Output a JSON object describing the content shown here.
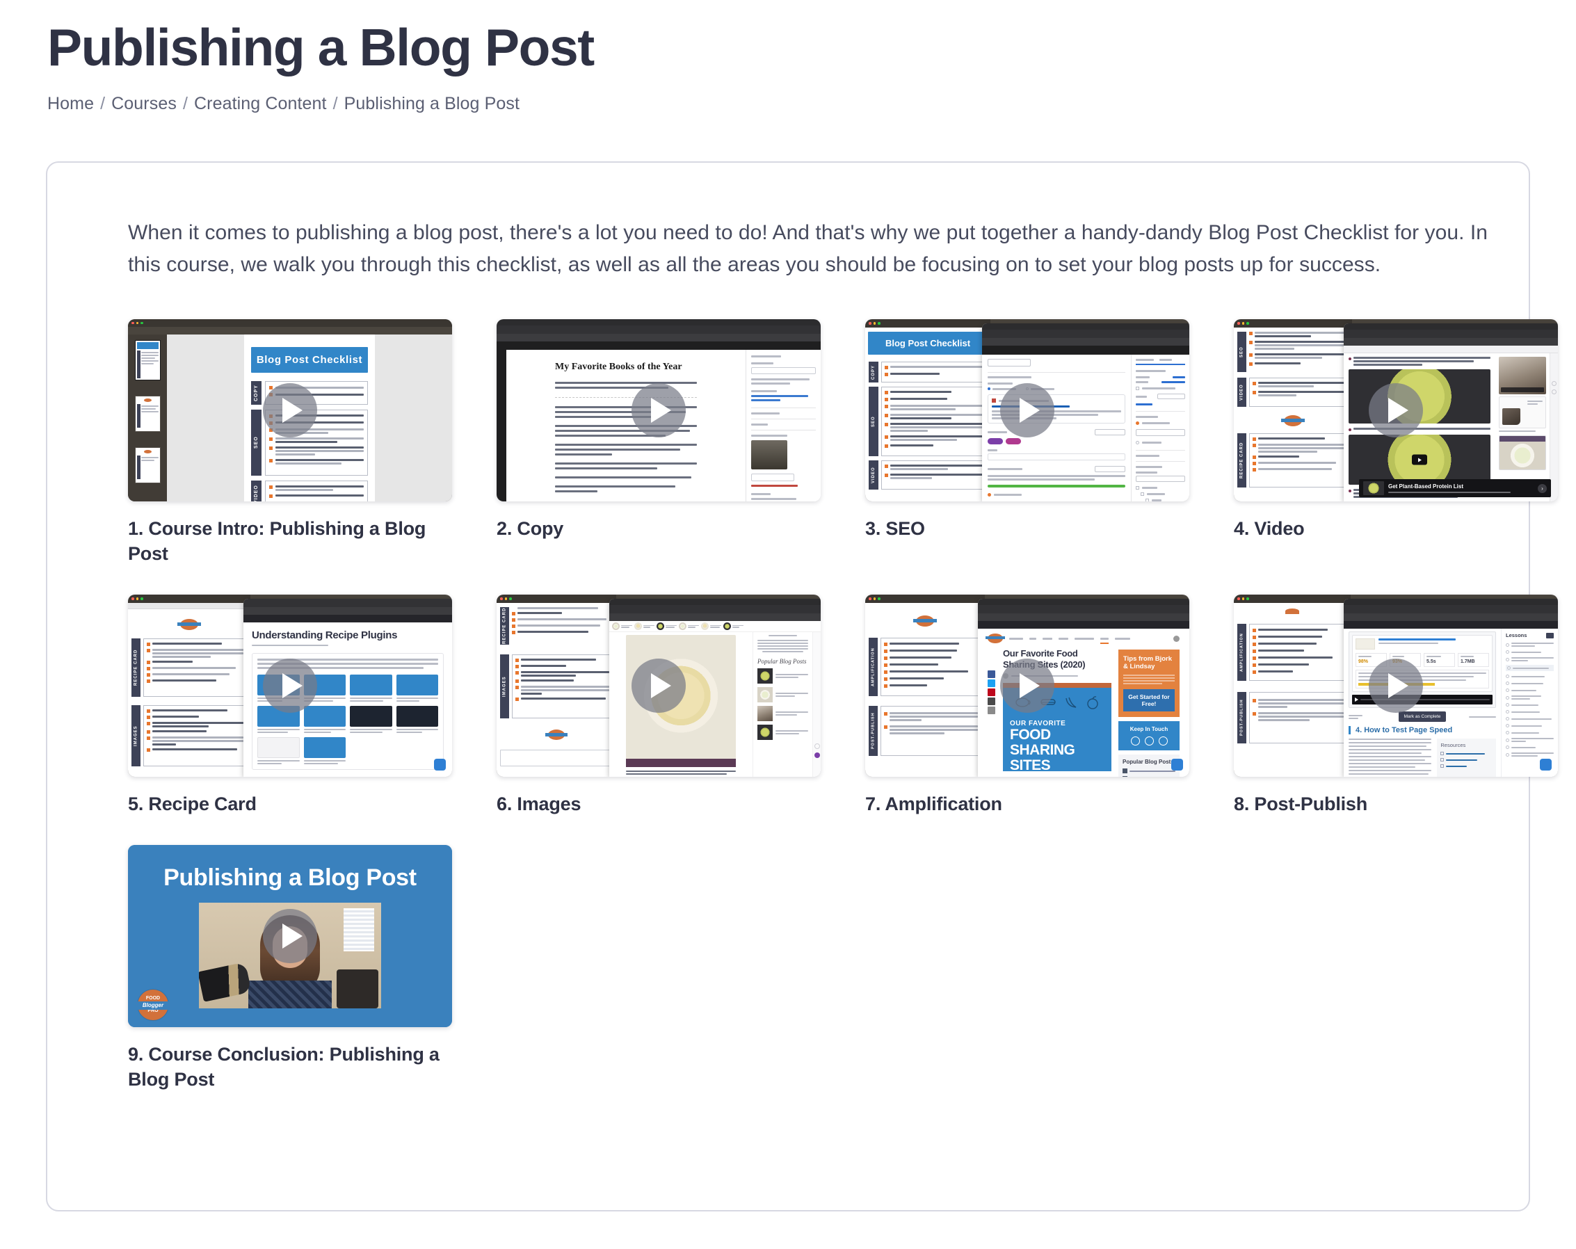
{
  "header": {
    "title": "Publishing a Blog Post",
    "breadcrumb": [
      "Home",
      "Courses",
      "Creating Content",
      "Publishing a Blog Post"
    ],
    "separator": "/"
  },
  "card": {
    "intro": "When it comes to publishing a blog post, there's a lot you need to do! And that's why we put together a handy-dandy Blog Post Checklist for you. In this course, we walk you through this checklist, as well as all the areas you should be focusing on to set your blog posts up for success."
  },
  "lessons": [
    {
      "number": "1.",
      "title": "1. Course Intro: Publishing a Blog Post",
      "thumb_kind": "pdf-checklist",
      "thumb_heading": "Blog Post Checklist"
    },
    {
      "number": "2.",
      "title": "2. Copy",
      "thumb_kind": "wp-editor",
      "thumb_heading": "My Favorite Books of the Year"
    },
    {
      "number": "3.",
      "title": "3. SEO",
      "thumb_kind": "seo-split",
      "thumb_heading": "Blog Post Checklist"
    },
    {
      "number": "4.",
      "title": "4. Video",
      "thumb_kind": "video-split",
      "thumb_heading": "Get Plant-Based Protein List"
    },
    {
      "number": "5.",
      "title": "5. Recipe Card",
      "thumb_kind": "recipe-plugins",
      "thumb_heading": "Understanding Recipe Plugins"
    },
    {
      "number": "6.",
      "title": "6. Images",
      "thumb_kind": "images-split",
      "thumb_heading": "popular POSTS"
    },
    {
      "number": "7.",
      "title": "7. Amplification",
      "thumb_kind": "amplification-split",
      "thumb_heading": "Our Favorite Food Sharing Sites (2020)"
    },
    {
      "number": "8.",
      "title": "8. Post-Publish",
      "thumb_kind": "postpublish-split",
      "thumb_heading": "4. How to Test Page Speed"
    },
    {
      "number": "9.",
      "title": "9. Course Conclusion: Publishing a Blog Post",
      "thumb_kind": "conclusion-slide",
      "thumb_heading": "Publishing a Blog Post"
    }
  ],
  "thumb_details": {
    "play_icon": "play-icon",
    "checklist_sections": [
      "COPY",
      "SEO",
      "VIDEO",
      "RECIPE CARD",
      "IMAGES",
      "AMPLIFICATION",
      "POST-PUBLISH"
    ],
    "seo_tips_box": "Tips from Bjork & Lindsay",
    "seo_cta": "Get Started for Free!",
    "amplification_banner_lines": [
      "OUR FAVORITE",
      "FOOD",
      "SHARING",
      "SITES"
    ],
    "keep_in_touch": "Keep In Touch",
    "popular_blog_posts": "Popular Blog Posts",
    "video_ad_title": "Get Plant-Based Protein List",
    "badge_lines": [
      "FOOD",
      "Blogger",
      "PRO"
    ],
    "lessons_panel": "Lessons"
  },
  "colors": {
    "title": "#2f3244",
    "body": "#474b5e",
    "breadcrumb": "#5b5f73",
    "card_border": "#d7d8e2",
    "accent_blue": "#3186c8",
    "accent_orange": "#e8762d",
    "slide_blue": "#3a81bd"
  }
}
